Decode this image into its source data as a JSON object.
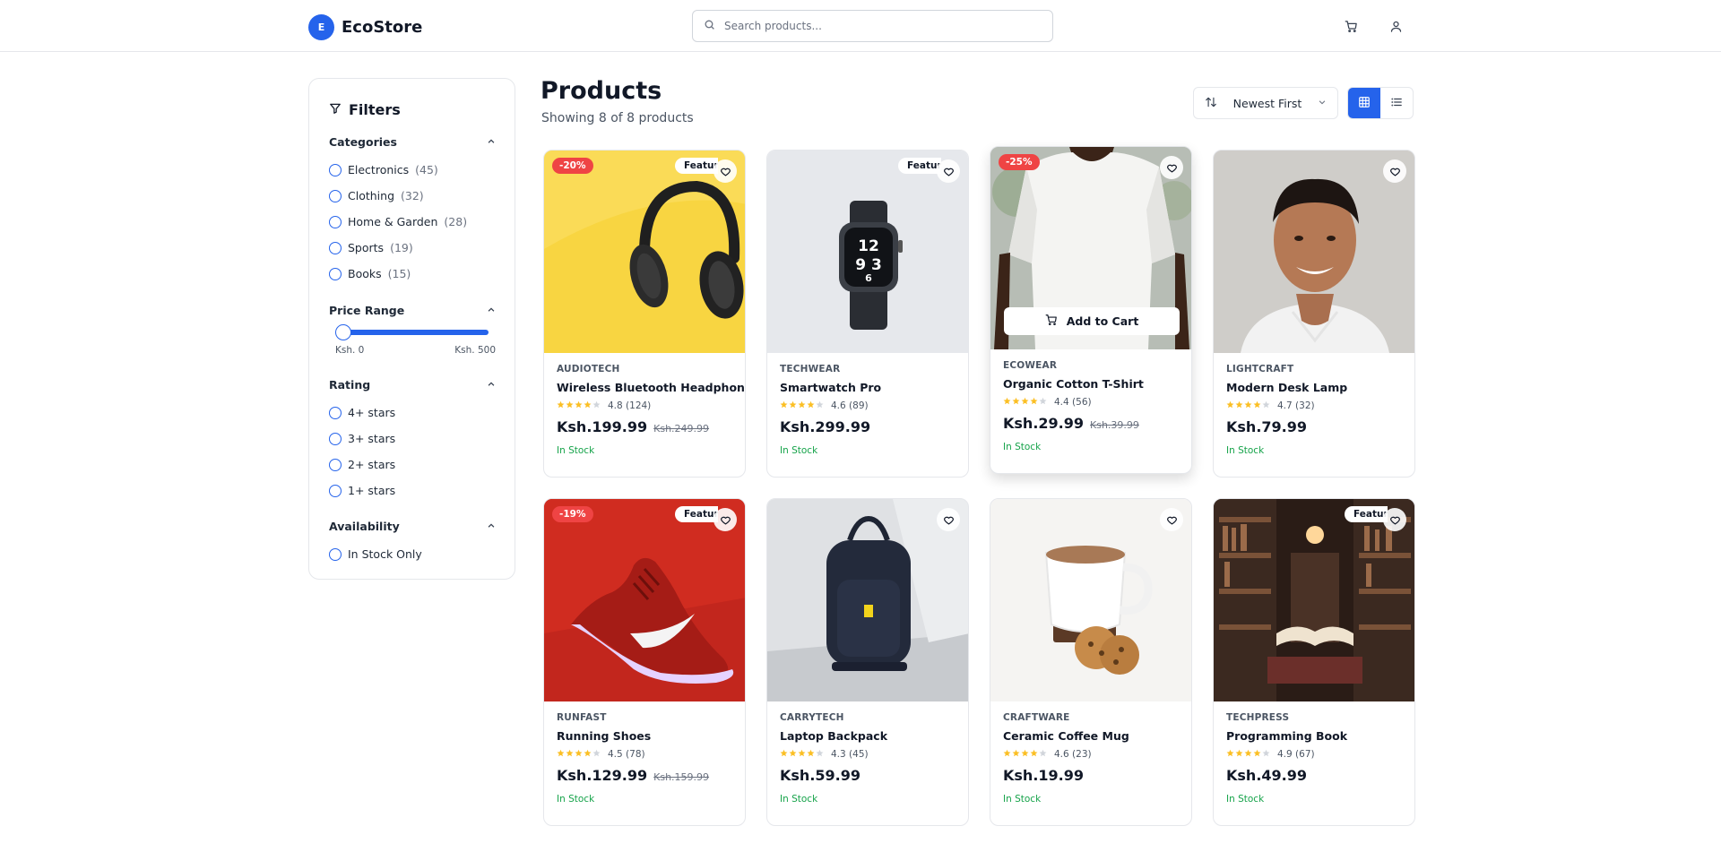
{
  "header": {
    "logo_letter": "E",
    "brand": "EcoStore",
    "search_placeholder": "Search products..."
  },
  "filters": {
    "title": "Filters",
    "categories": {
      "title": "Categories",
      "items": [
        {
          "label": "Electronics",
          "count": "(45)"
        },
        {
          "label": "Clothing",
          "count": "(32)"
        },
        {
          "label": "Home & Garden",
          "count": "(28)"
        },
        {
          "label": "Sports",
          "count": "(19)"
        },
        {
          "label": "Books",
          "count": "(15)"
        }
      ]
    },
    "price": {
      "title": "Price Range",
      "min_label": "Ksh. 0",
      "max_label": "Ksh. 500",
      "selected_min": 0
    },
    "rating": {
      "title": "Rating",
      "items": [
        "4+ stars",
        "3+ stars",
        "2+ stars",
        "1+ stars"
      ]
    },
    "availability": {
      "title": "Availability",
      "items": [
        "In Stock Only"
      ]
    }
  },
  "main": {
    "title": "Products",
    "subtitle": "Showing 8 of 8 products",
    "sort_label": "Newest First",
    "view_mode": "grid"
  },
  "colors": {
    "accent": "#2563eb",
    "discount": "#ef4444",
    "in_stock": "#16a34a",
    "star": "#fbbf24"
  },
  "products": [
    {
      "brand": "AUDIOTECH",
      "name": "Wireless Bluetooth Headphones",
      "rating": "4.8",
      "reviews": "(124)",
      "stars": 4,
      "price": "Ksh.199.99",
      "old_price": "Ksh.249.99",
      "discount": "-20%",
      "featured": "Featured",
      "stock": "In Stock",
      "image": "headphones"
    },
    {
      "brand": "TECHWEAR",
      "name": "Smartwatch Pro",
      "rating": "4.6",
      "reviews": "(89)",
      "stars": 4,
      "price": "Ksh.299.99",
      "old_price": "",
      "discount": "",
      "featured": "Featured",
      "stock": "In Stock",
      "image": "smartwatch"
    },
    {
      "brand": "ECOWEAR",
      "name": "Organic Cotton T-Shirt",
      "rating": "4.4",
      "reviews": "(56)",
      "stars": 4,
      "price": "Ksh.29.99",
      "old_price": "Ksh.39.99",
      "discount": "-25%",
      "featured": "",
      "stock": "In Stock",
      "image": "tshirt",
      "add_to_cart": "Add to Cart"
    },
    {
      "brand": "LIGHTCRAFT",
      "name": "Modern Desk Lamp",
      "rating": "4.7",
      "reviews": "(32)",
      "stars": 4,
      "price": "Ksh.79.99",
      "old_price": "",
      "discount": "",
      "featured": "",
      "stock": "In Stock",
      "image": "portrait"
    },
    {
      "brand": "RUNFAST",
      "name": "Running Shoes",
      "rating": "4.5",
      "reviews": "(78)",
      "stars": 4,
      "price": "Ksh.129.99",
      "old_price": "Ksh.159.99",
      "discount": "-19%",
      "featured": "Featured",
      "stock": "In Stock",
      "image": "shoe"
    },
    {
      "brand": "CARRYTECH",
      "name": "Laptop Backpack",
      "rating": "4.3",
      "reviews": "(45)",
      "stars": 4,
      "price": "Ksh.59.99",
      "old_price": "",
      "discount": "",
      "featured": "",
      "stock": "In Stock",
      "image": "backpack"
    },
    {
      "brand": "CRAFTWARE",
      "name": "Ceramic Coffee Mug",
      "rating": "4.6",
      "reviews": "(23)",
      "stars": 4,
      "price": "Ksh.19.99",
      "old_price": "",
      "discount": "",
      "featured": "",
      "stock": "In Stock",
      "image": "mug"
    },
    {
      "brand": "TECHPRESS",
      "name": "Programming Book",
      "rating": "4.9",
      "reviews": "(67)",
      "stars": 4,
      "price": "Ksh.49.99",
      "old_price": "",
      "discount": "",
      "featured": "Featured",
      "stock": "In Stock",
      "image": "library"
    }
  ]
}
